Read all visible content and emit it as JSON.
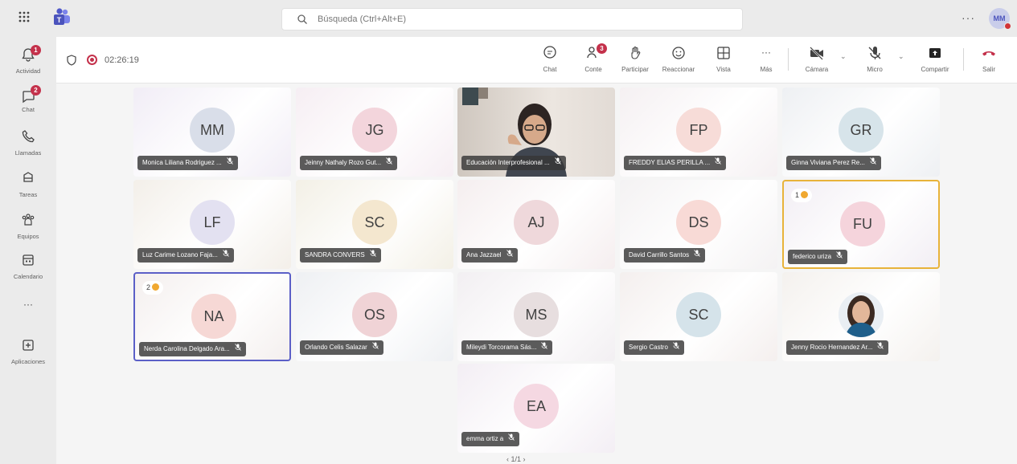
{
  "topbar": {
    "search_placeholder": "Búsqueda (Ctrl+Alt+E)",
    "more": "···",
    "user_initials": "MM"
  },
  "rail": {
    "items": [
      {
        "label": "Actividad",
        "badge": "1"
      },
      {
        "label": "Chat",
        "badge": "2"
      },
      {
        "label": "Llamadas"
      },
      {
        "label": "Tareas"
      },
      {
        "label": "Equipos"
      },
      {
        "label": "Calendario"
      },
      {
        "label": "···"
      },
      {
        "label": "Aplicaciones"
      }
    ]
  },
  "meeting": {
    "timer": "02:26:19",
    "toolbar": {
      "chat": "Chat",
      "people": "Conte",
      "people_badge": "3",
      "raise": "Participar",
      "react": "Reaccionar",
      "view": "Vista",
      "more": "Más",
      "camera": "Cámara",
      "mic": "Micro",
      "share": "Compartir",
      "leave": "Salir"
    }
  },
  "tiles": [
    {
      "initials": "MM",
      "name": "Monica Liliana Rodriguez ...",
      "bg": "#f1edf6",
      "avbg": "#d9dee9"
    },
    {
      "initials": "JG",
      "name": "Jeinny Nathaly Rozo Gut...",
      "bg": "#f6eef3",
      "avbg": "#f3d5dc"
    },
    {
      "initials": "",
      "name": "Educación Interprofesional ...",
      "bg": "#d6cfc8",
      "avbg": "transparent"
    },
    {
      "initials": "FP",
      "name": "FREDDY ELIAS PERILLA ...",
      "bg": "#f5f0f2",
      "avbg": "#f7dcd8"
    },
    {
      "initials": "GR",
      "name": "Ginna Viviana Perez Re...",
      "bg": "#eef0f3",
      "avbg": "#d7e4ea"
    },
    {
      "initials": "LF",
      "name": "Luz Carime Lozano Fajа...",
      "bg": "#f3efe9",
      "avbg": "#e3e1f1"
    },
    {
      "initials": "SC",
      "name": "SANDRA CONVERS",
      "bg": "#f3f0e6",
      "avbg": "#f4e7cf"
    },
    {
      "initials": "AJ",
      "name": "Ana Jazzael",
      "bg": "#f5eeef",
      "avbg": "#efd8db"
    },
    {
      "initials": "DS",
      "name": "David Carrillo Santos",
      "bg": "#f4f2f3",
      "avbg": "#f8dad6"
    },
    {
      "initials": "FU",
      "name": "federico uriza",
      "bg": "#f2eef4",
      "avbg": "#f5d4dc",
      "hand": "1"
    },
    {
      "initials": "NA",
      "name": "Nerda Carolina Delgado Ara...",
      "bg": "#f4efee",
      "avbg": "#f6d8d5",
      "hand": "2"
    },
    {
      "initials": "OS",
      "name": "Orlando Celis Salazar",
      "bg": "#eef0f3",
      "avbg": "#f0d3d6"
    },
    {
      "initials": "MS",
      "name": "Mileydi Torcorama Sás...",
      "bg": "#f2eff2",
      "avbg": "#e7dedf"
    },
    {
      "initials": "SC",
      "name": "Sergio Castro",
      "bg": "#f4efee",
      "avbg": "#d5e3ea"
    },
    {
      "initials": "",
      "name": "Jenny Rocio Hernandez Ar...",
      "bg": "#f4f1ee",
      "avbg": "transparent"
    },
    {
      "initials": "EA",
      "name": "emma ortiz a",
      "bg": "#f3eef4",
      "avbg": "#f5d8e2"
    }
  ],
  "pager": "‹ 1/1 ›"
}
